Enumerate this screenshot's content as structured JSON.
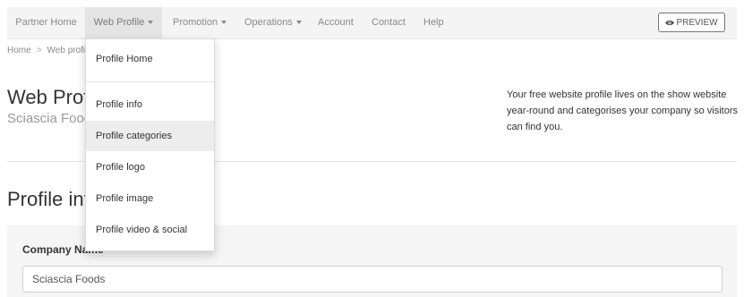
{
  "nav": {
    "items": [
      {
        "label": "Partner Home",
        "dropdown": false,
        "active": false
      },
      {
        "label": "Web Profile",
        "dropdown": true,
        "active": true
      },
      {
        "label": "Promotion",
        "dropdown": true,
        "active": false
      },
      {
        "label": "Operations",
        "dropdown": true,
        "active": false
      },
      {
        "label": "Account",
        "dropdown": false,
        "active": false
      },
      {
        "label": "Contact",
        "dropdown": false,
        "active": false
      },
      {
        "label": "Help",
        "dropdown": false,
        "active": false
      }
    ],
    "preview_label": "PREVIEW"
  },
  "breadcrumb": {
    "home": "Home",
    "separator": ">",
    "current": "Web profile"
  },
  "header": {
    "title": "Web Profile",
    "company": "Sciascia Foods",
    "intro": "Your free website profile lives on the show website year-round and categorises your company so visitors can find you."
  },
  "section": {
    "title": "Profile info"
  },
  "form": {
    "company_name_label": "Company Name",
    "company_name_value": "Sciascia Foods"
  },
  "dropdown_menu": {
    "items": [
      {
        "label": "Profile Home"
      },
      {
        "label": "Profile info"
      },
      {
        "label": "Profile categories",
        "hover": true
      },
      {
        "label": "Profile logo"
      },
      {
        "label": "Profile image"
      },
      {
        "label": "Profile video & social"
      }
    ]
  },
  "colors": {
    "navbar_bg": "#f4f4f4",
    "nav_active_bg": "#e4e4e4",
    "menu_hover_bg": "#ededed",
    "muted_text": "#9a9a9a"
  }
}
